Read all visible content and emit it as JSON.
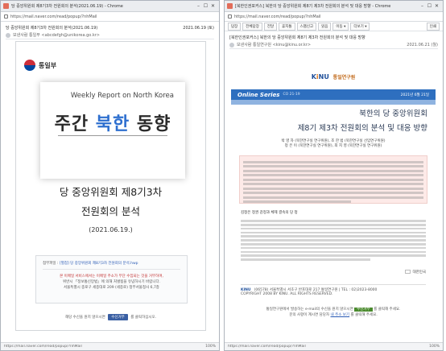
{
  "win1": {
    "title": "당 중앙위원회 제8기3차 전원회의 분석(2021.06.19) - Chrome",
    "url": "https://mail.naver.com/read/popup/?nhMail",
    "mail_subject": "당 중앙위원회 제8기3차 전원회의 분석(2021.06.19)",
    "mail_date": "2021.06.19 (토)",
    "sender_label": "보낸사람",
    "sender_name": "통일부",
    "sender_addr": "<abcdefgh@unikorea.go.kr>",
    "org": "통일부",
    "cover_en": "Weekly Report on North Korea",
    "cover_ko_a": "주간 ",
    "cover_ko_b": "북한",
    "cover_ko_c": " 동향",
    "title_line1": "당 중앙위원회 제8기3차",
    "title_line2": "전원회의 분석",
    "date": "(2021.06.19.)",
    "attach_label": "첨부파일 :",
    "attach_name": "[별첨] 당 중앙위원회 제8기3차 전원회의 분석.hwp",
    "info_line1": "본 이메일 서비스에서는 이메일 주소가 무단 수집되는 것을 거부하며,",
    "info_line2": "위반시 「정보통신망법」에 의해 처벌됨을 유념하시기 바랍니다.",
    "info_line3": "서울특별시 종로구 세종대로 209 (세종로) 정부서울청사 6,7층",
    "sub_pre": "해당 수신을 원치 않으시면",
    "sub_btn": "수신거부",
    "sub_post": "를 클릭하십시오.",
    "status": "https://mail.naver.com/read/popup/?nhMail",
    "zoom": "100%"
  },
  "win2": {
    "title": "[북한인권포커스] 북한의 당 중앙위원회 제8기 제3차 전원회의 분석 및 대응 방향 - Chrome",
    "url": "https://mail.naver.com/read/popup/?nhMail",
    "toolbar": [
      "답장",
      "전체답장",
      "전달",
      "휴지통",
      "스팸신고",
      "읽음",
      "이동 ▾",
      "더보기 ▾"
    ],
    "print_label": "인쇄",
    "mail_subject": "[북한인권포커스] 북한의 당 중앙위원회 제8기 제3차 전원회의 분석 및 대응 방향",
    "mail_date": "2021.06.21 (월)",
    "sender_label": "보낸사람",
    "sender_name": "통일연구원",
    "sender_addr": "<kinu@kinu.or.kr>",
    "kinu_k": "K",
    "kinu_i": "i",
    "kinu_nu": "NU",
    "kinu_name": "통일연구원",
    "series": "Online Series",
    "series_code": "CO 21-19",
    "series_date": "2021년 6월 21일",
    "headline1": "북한의 당 중앙위원회",
    "headline2": "제8기 제3차 전원회의 분석 및 대응 방향",
    "authors1": "박 영 자 (북한연구실 연구위원), 조 한 범 (북한연구실 선임연구위원)",
    "authors2": "정 은 이 (북한연구실 연구위원), 최 지 영 (북한연구실 연구위원)",
    "section_title": "김정은 정권 감정과 체제 결속의 당 정",
    "flag_label": "대한민국",
    "footer_org": "KINU",
    "footer_addr": "(06578) 서울특별시 서초구 반포대로 217 통일연구원 | TEL : 02)2023-8000",
    "footer_copy": "COPYRIGHT 2008 BY KINU. ALL RIGHTS RESERVED.",
    "foot_line1_pre": "통일연구원에서 발송하는 e-mail의 수신을 원치 않으시면",
    "foot_sub": "수신거부",
    "foot_line1_post": "를 클릭해 주세요.",
    "foot_line2_pre": "문의 사항이 계시면 담당자",
    "foot_link": "내 주소 보기",
    "foot_line2_post": "를 클릭해 주세요.",
    "status": "https://mail.naver.com/read/popup/?nhMail",
    "zoom": "100%"
  }
}
